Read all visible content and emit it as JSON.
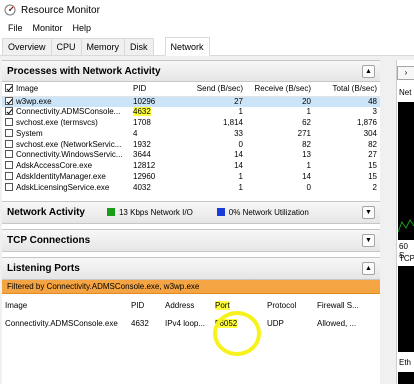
{
  "window": {
    "title": "Resource Monitor"
  },
  "menu": [
    "File",
    "Monitor",
    "Help"
  ],
  "tabs": [
    "Overview",
    "CPU",
    "Memory",
    "Disk",
    "Network"
  ],
  "active_tab": "Network",
  "processes": {
    "title": "Processes with Network Activity",
    "columns": [
      "Image",
      "PID",
      "Send (B/sec)",
      "Receive (B/sec)",
      "Total (B/sec)"
    ],
    "rows": [
      {
        "image": "w3wp.exe",
        "pid": "10296",
        "send": "27",
        "receive": "20",
        "total": "48",
        "checked": true
      },
      {
        "image": "Connectivity.ADMSConsole...",
        "pid": "4632",
        "send": "1",
        "receive": "1",
        "total": "3",
        "checked": true
      },
      {
        "image": "svchost.exe (termsvcs)",
        "pid": "1708",
        "send": "1,814",
        "receive": "62",
        "total": "1,876",
        "checked": false
      },
      {
        "image": "System",
        "pid": "4",
        "send": "33",
        "receive": "271",
        "total": "304",
        "checked": false
      },
      {
        "image": "svchost.exe (NetworkServic...",
        "pid": "1932",
        "send": "0",
        "receive": "82",
        "total": "82",
        "checked": false
      },
      {
        "image": "Connectivity.WindowsServic...",
        "pid": "3644",
        "send": "14",
        "receive": "13",
        "total": "27",
        "checked": false
      },
      {
        "image": "AdskAccessCore.exe",
        "pid": "12812",
        "send": "14",
        "receive": "1",
        "total": "15",
        "checked": false
      },
      {
        "image": "AdskIdentityManager.exe",
        "pid": "12960",
        "send": "1",
        "receive": "14",
        "total": "15",
        "checked": false
      },
      {
        "image": "AdskLicensingService.exe",
        "pid": "4032",
        "send": "1",
        "receive": "0",
        "total": "2",
        "checked": false
      }
    ]
  },
  "network_activity": {
    "title": "Network Activity",
    "io_text": "13 Kbps Network I/O",
    "util_text": "0% Network Utilization"
  },
  "tcp": {
    "title": "TCP Connections"
  },
  "listening": {
    "title": "Listening Ports",
    "filter": "Filtered by Connectivity.ADMSConsole.exe, w3wp.exe",
    "columns": [
      "Image",
      "PID",
      "Address",
      "Port",
      "Protocol",
      "Firewall S..."
    ],
    "rows": [
      {
        "image": "Connectivity.ADMSConsole.exe",
        "pid": "4632",
        "address": "IPv4 loop...",
        "port": "56052",
        "protocol": "UDP",
        "firewall": "Allowed, ..."
      }
    ]
  },
  "right_panel": {
    "labels": [
      "Net",
      "60 S",
      "TCP",
      "Eth"
    ]
  },
  "colors": {
    "io_green": "#1a9c1a",
    "util_blue": "#1a3bd6",
    "highlight": "#ffff3c",
    "filter_orange": "#f5a443"
  }
}
